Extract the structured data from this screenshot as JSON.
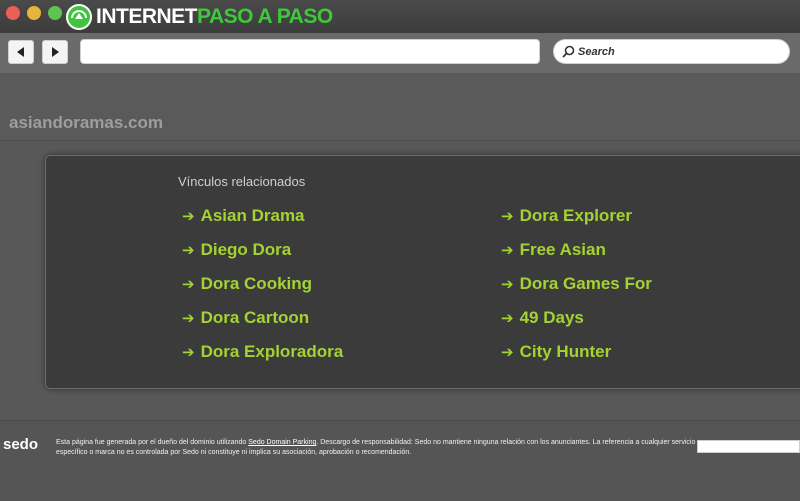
{
  "brand": {
    "part1": "Internet",
    "part2": "Paso a Paso"
  },
  "toolbar": {
    "url_value": "",
    "search_placeholder": "Search"
  },
  "site": {
    "domain": "asiandoramas.com"
  },
  "related": {
    "heading": "Vínculos relacionados",
    "arrow": "➔",
    "left": [
      "Asian Drama",
      "Diego Dora",
      "Dora Cooking",
      "Dora Cartoon",
      "Dora Exploradora"
    ],
    "right": [
      "Dora Explorer",
      "Free Asian",
      "Dora Games For",
      "49 Days",
      "City Hunter"
    ]
  },
  "footer": {
    "logo": "sedo",
    "text_before": "Esta página fue generada por el dueño del dominio utilizando ",
    "link": "Sedo Domain Parking",
    "text_after": ". Descargo de responsabilidad: Sedo no mantiene ninguna relación con los anunciantes. La referencia a cualquier servicio específico o marca no es controlada por Sedo ni constituye ni implica su asociación, aprobación o recomendación."
  },
  "colors": {
    "link": "#a4d233",
    "brand_green": "#3fc83a",
    "panel_bg": "#3b3b3b",
    "page_bg": "#585858"
  }
}
